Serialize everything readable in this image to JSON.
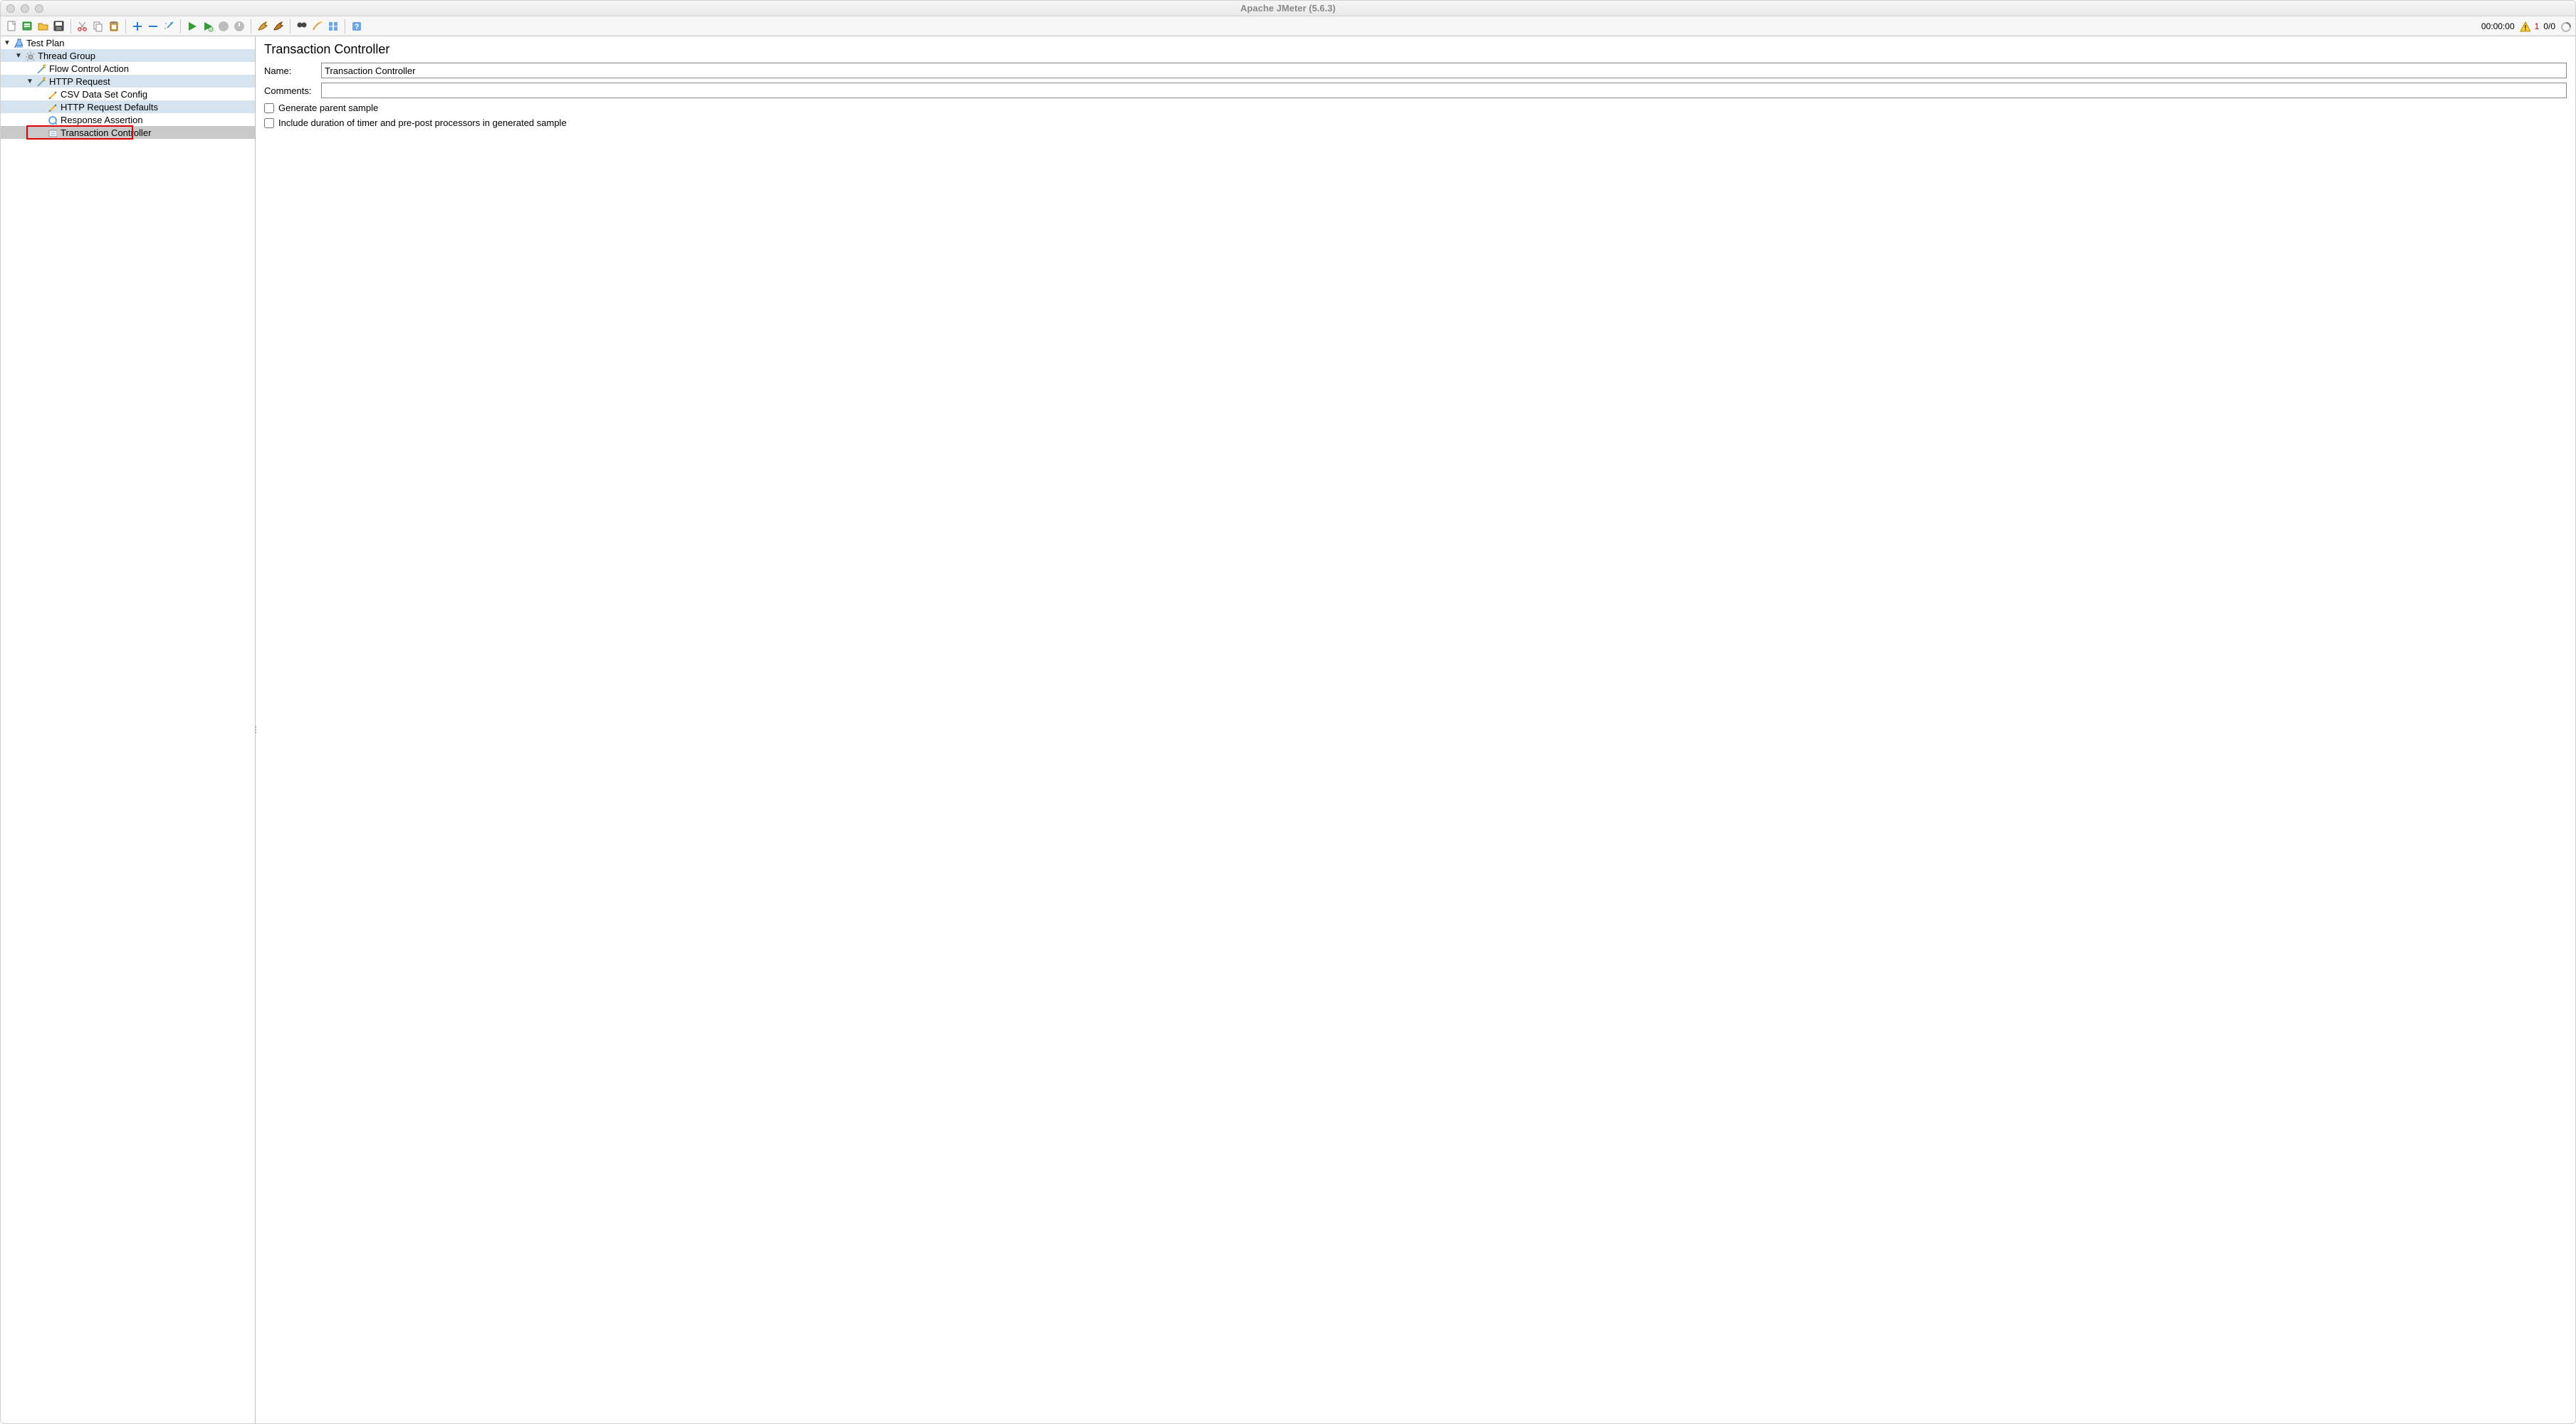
{
  "window_title": "Apache JMeter (5.6.3)",
  "toolbar_icons": [
    "new-file-icon",
    "templates-icon",
    "open-icon",
    "save-icon",
    "sep",
    "cut-icon",
    "copy-icon",
    "paste-icon",
    "sep",
    "plus-icon",
    "minus-icon",
    "wand-icon",
    "sep",
    "play-icon",
    "play-nosave-icon",
    "stop-icon",
    "shutdown-icon",
    "sep",
    "clear-icon",
    "clear-all-icon",
    "sep",
    "search-icon",
    "reset-search-icon",
    "function-helper-icon",
    "sep",
    "help-icon"
  ],
  "status": {
    "elapsed": "00:00:00",
    "warn_count": "1",
    "threads": "0/0"
  },
  "tree": [
    {
      "label": "Test Plan",
      "indent": 0,
      "disclosure": "▼",
      "icon": "flask-icon",
      "selected": ""
    },
    {
      "label": "Thread Group",
      "indent": 1,
      "disclosure": "▼",
      "icon": "threadgroup-icon",
      "selected": "sel-light"
    },
    {
      "label": "Flow Control Action",
      "indent": 2,
      "disclosure": "",
      "icon": "sampler-icon",
      "selected": ""
    },
    {
      "label": "HTTP Request",
      "indent": 2,
      "disclosure": "▼",
      "icon": "sampler-icon",
      "selected": "sel-light"
    },
    {
      "label": "CSV Data Set Config",
      "indent": 3,
      "disclosure": "",
      "icon": "config-icon",
      "selected": ""
    },
    {
      "label": "HTTP Request Defaults",
      "indent": 3,
      "disclosure": "",
      "icon": "config-icon",
      "selected": "sel-light"
    },
    {
      "label": "Response Assertion",
      "indent": 3,
      "disclosure": "",
      "icon": "assertion-icon",
      "selected": ""
    },
    {
      "label": "Transaction Controller",
      "indent": 3,
      "disclosure": "",
      "icon": "controller-icon",
      "selected": "sel-grey",
      "highlighted": true
    }
  ],
  "detail": {
    "heading": "Transaction Controller",
    "name_label": "Name:",
    "name_value": "Transaction Controller",
    "comments_label": "Comments:",
    "comments_value": "",
    "check1_label": "Generate parent sample",
    "check2_label": "Include duration of timer and pre-post processors in generated sample"
  }
}
